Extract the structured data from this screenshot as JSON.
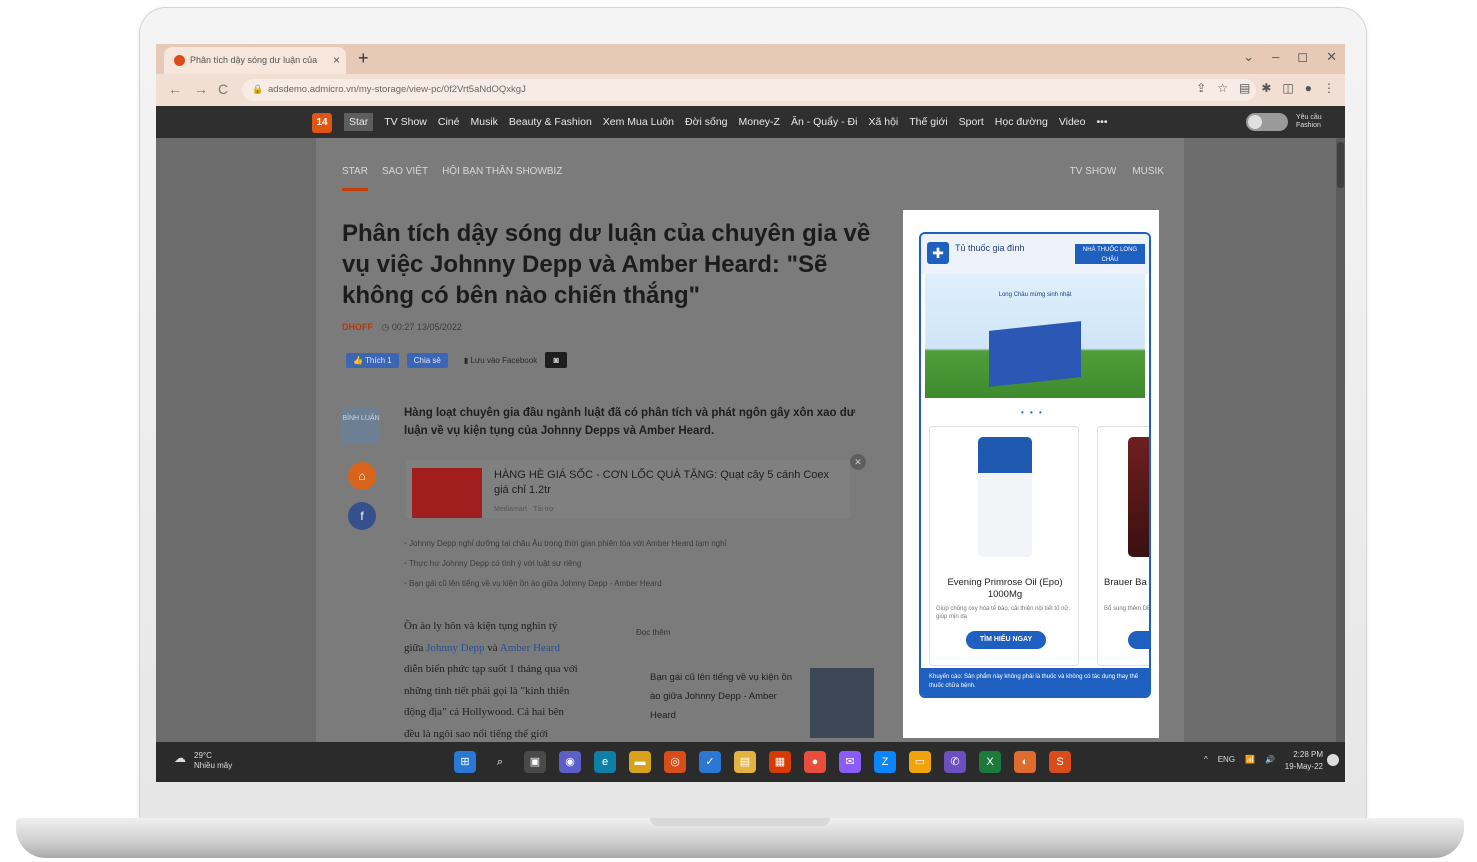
{
  "browser": {
    "tab_title": "Phân tích dậy sóng dư luận của",
    "tab_close": "×",
    "new_tab": "+",
    "url": "adsdemo.admicro.vn/my-storage/view-pc/0f2Vrt5aNdOQxkgJ",
    "window_controls": [
      "⌄",
      "–",
      "◻",
      "✕"
    ],
    "nav": {
      "back": "←",
      "forward": "→",
      "reload": "C"
    }
  },
  "site_nav": {
    "logo": "14",
    "items": [
      "Star",
      "TV Show",
      "Ciné",
      "Musik",
      "Beauty & Fashion",
      "Xem Mua Luôn",
      "Đời sống",
      "Money-Z",
      "Ăn - Quẩy - Đi",
      "Xã hội",
      "Thế giới",
      "Sport",
      "Học đường",
      "Video",
      "•••"
    ],
    "active_index": 0,
    "toggle_label": "Yêu cầu Fashion"
  },
  "article": {
    "subnav_left": [
      "STAR",
      "SAO VIỆT",
      "HỘI BẠN THÂN SHOWBIZ"
    ],
    "subnav_right": [
      "TV SHOW",
      "MUSIK"
    ],
    "headline": "Phân tích dậy sóng dư luận của chuyên gia về vụ việc Johnny Depp và Amber Heard: \"Sẽ không có bên nào chiến thắng\"",
    "author": "DHOFF",
    "timestamp": "00:27 13/05/2022",
    "share": {
      "like": "👍 Thích 1",
      "share": "Chia sẻ",
      "save": "Lưu vào Facebook"
    },
    "side_badge": "BÌNH LUẬN",
    "sapo": "Hàng loạt chuyên gia đầu ngành luật đã có phân tích và phát ngôn gây xôn xao dư luận về vụ kiện tụng của Johnny Depps và Amber Heard.",
    "inline_ad": {
      "title": "HÀNG HÈ GIÁ SỐC - CƠN LỐC QUÀ TẶNG: Quạt cây 5 cánh Coex giá chỉ 1.2tr",
      "source": "Mediamart · Tài trợ"
    },
    "related": [
      "Johnny Depp nghỉ dưỡng tại châu Âu trong thời gian phiên tòa với Amber Heard tạm nghỉ",
      "Thực hư Johnny Depp có tình ý với luật sư riêng",
      "Bạn gái cũ lên tiếng về vụ kiện ồn ào giữa Johnny Depp - Amber Heard"
    ],
    "body_lines": [
      "Ồn ào ly hôn và kiện tụng nghìn tỷ",
      "giữa ",
      "Johnny Depp",
      " và ",
      "Amber Heard",
      "diễn biến phức tạp suốt 1 tháng qua với",
      "những tình tiết phải gọi là \"kinh thiên",
      "động địa\" cả Hollywood. Cả hai bên",
      "đều là ngôi sao nổi tiếng thế giới"
    ],
    "read_more_label": "Đọc thêm",
    "read_more_title": "Bạn gái cũ lên tiếng về vụ kiện ồn ào giữa Johnny Depp - Amber Heard"
  },
  "ad_panel": {
    "header": "Tủ thuốc gia đình",
    "brand": "NHÀ THUỐC LONG CHÂU",
    "banner_text": "Long Châu mừng sinh nhật",
    "dots": "• • •",
    "products": [
      {
        "name": "Evening Primrose Oil (Epo) 1000Mg",
        "desc": "Giúp chống oxy hóa tế bào, cải thiện nội tiết tố nữ, giúp mịn da",
        "button": "TÌM HIỂU NGAY"
      },
      {
        "name": "Brauer Ba",
        "desc": "Bổ sung thêm DE-Hàng & Ca",
        "button": "TÌ"
      }
    ],
    "footer": "Khuyến cáo: Sản phẩm này không phải là thuốc và không có tác dụng thay thế thuốc chữa bệnh."
  },
  "taskbar": {
    "weather_temp": "29°C",
    "weather_desc": "Nhiều mây",
    "tray": [
      "^",
      "ENG",
      "📶",
      "🔊"
    ],
    "time": "2:28 PM",
    "date": "19-May-22"
  },
  "colors": {
    "accent": "#c83c0c",
    "ad_blue": "#1f5fbf",
    "nav_bg": "#2f2f2f"
  }
}
